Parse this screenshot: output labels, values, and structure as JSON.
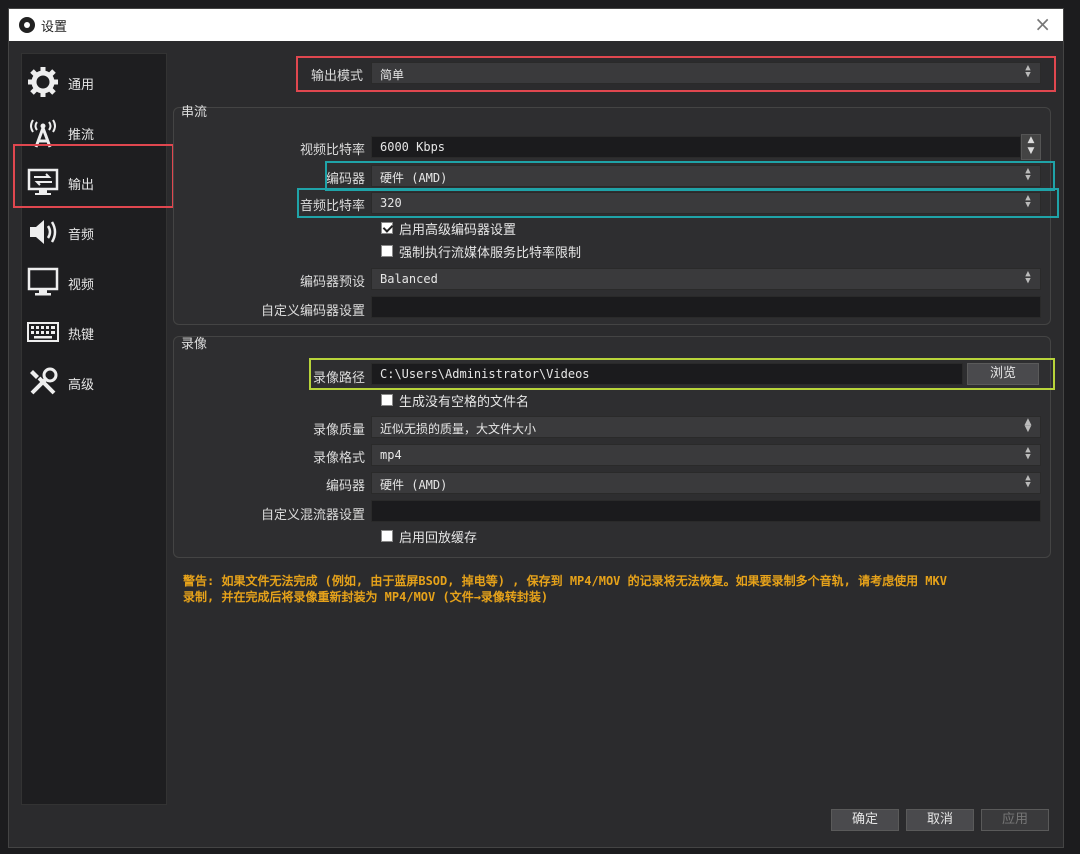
{
  "window": {
    "title": "设置"
  },
  "sidebar": {
    "items": [
      {
        "label": "通用",
        "icon": "gear-icon"
      },
      {
        "label": "推流",
        "icon": "antenna-icon"
      },
      {
        "label": "输出",
        "icon": "monitor-arrow-icon"
      },
      {
        "label": "音频",
        "icon": "speaker-icon"
      },
      {
        "label": "视频",
        "icon": "monitor-icon"
      },
      {
        "label": "热键",
        "icon": "keyboard-icon"
      },
      {
        "label": "高级",
        "icon": "tools-icon"
      }
    ],
    "active_index": 2
  },
  "output_mode": {
    "label": "输出模式",
    "value": "简单"
  },
  "streaming": {
    "title": "串流",
    "video_bitrate": {
      "label": "视频比特率",
      "value": "6000 Kbps"
    },
    "encoder": {
      "label": "编码器",
      "value": "硬件 (AMD)"
    },
    "audio_bitrate": {
      "label": "音频比特率",
      "value": "320"
    },
    "advanced_encoder": {
      "label": "启用高级编码器设置",
      "checked": true
    },
    "enforce_limits": {
      "label": "强制执行流媒体服务比特率限制",
      "checked": false
    },
    "encoder_preset": {
      "label": "编码器预设",
      "value": "Balanced"
    },
    "custom_encoder": {
      "label": "自定义编码器设置",
      "value": ""
    }
  },
  "recording": {
    "title": "录像",
    "path": {
      "label": "录像路径",
      "value": "C:\\Users\\Administrator\\Videos",
      "browse": "浏览"
    },
    "no_space": {
      "label": "生成没有空格的文件名",
      "checked": false
    },
    "quality": {
      "label": "录像质量",
      "value": "近似无损的质量，大文件大小"
    },
    "format": {
      "label": "录像格式",
      "value": "mp4"
    },
    "encoder": {
      "label": "编码器",
      "value": "硬件 (AMD)"
    },
    "custom_muxer": {
      "label": "自定义混流器设置",
      "value": ""
    },
    "replay_buffer": {
      "label": "启用回放缓存",
      "checked": false
    }
  },
  "warning": {
    "line1": "警告: 如果文件无法完成 (例如, 由于蓝屏BSOD, 掉电等) , 保存到 MP4/MOV 的记录将无法恢复。如果要录制多个音轨, 请考虑使用 MKV",
    "line2": "录制, 并在完成后将录像重新封装为 MP4/MOV (文件→录像转封装)"
  },
  "footer": {
    "ok": "确定",
    "cancel": "取消",
    "apply": "应用"
  },
  "colors": {
    "highlight_red": "#e0474f",
    "highlight_cyan": "#1fa3a8",
    "highlight_lime": "#b8d43a",
    "warning": "#e6a21a"
  }
}
